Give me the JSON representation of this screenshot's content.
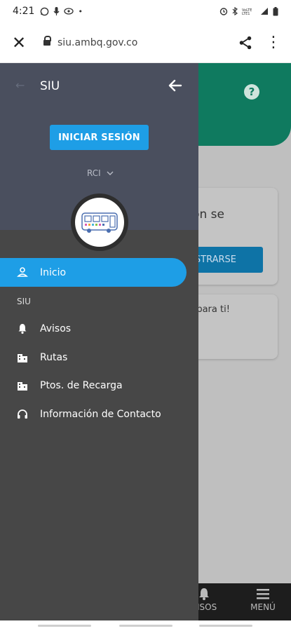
{
  "status_bar": {
    "time": "4:21"
  },
  "browser": {
    "url": "siu.ambq.gov.co"
  },
  "background": {
    "card1_text": "ción se",
    "card1_button": "GISTRARSE",
    "card2_text": "ón para ti!",
    "nav": [
      {
        "label": "VISOS"
      },
      {
        "label": "MENÚ"
      }
    ]
  },
  "drawer": {
    "title": "SIU",
    "faint_icon": "←",
    "login_button": "INICIAR SESIÓN",
    "selector": "RCI",
    "menu_active": {
      "label": "Inicio",
      "icon": "person-icon"
    },
    "section": "SIU",
    "items": [
      {
        "label": "Avisos",
        "icon": "bell-icon"
      },
      {
        "label": "Rutas",
        "icon": "building-icon"
      },
      {
        "label": "Ptos. de Recarga",
        "icon": "building-icon"
      },
      {
        "label": "Información de Contacto",
        "icon": "headset-icon"
      }
    ]
  },
  "colors": {
    "accent": "#1e9ee6",
    "header": "#0f7a5f",
    "drawer_bg": "#474747",
    "drawer_head": "#4a4f5e"
  }
}
